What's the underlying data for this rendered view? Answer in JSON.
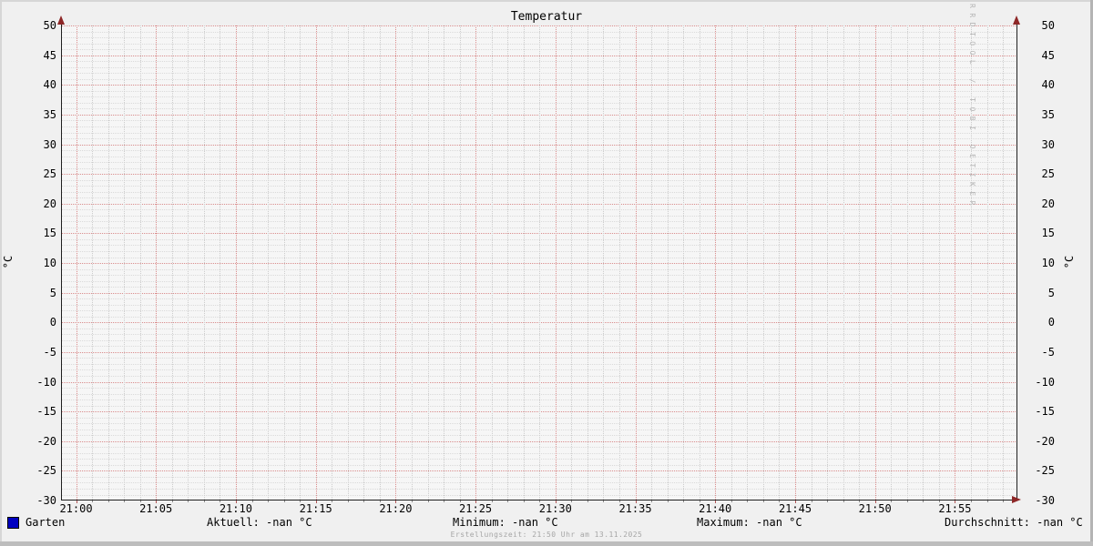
{
  "title": "Temperatur",
  "axes": {
    "y_unit_left": "°C",
    "y_unit_right": "°C"
  },
  "legend": {
    "series_label": "Garten",
    "series_swatch_color": "#0000c0",
    "stats": [
      {
        "text": "Aktuell: -nan °C"
      },
      {
        "text": "Minimum: -nan °C"
      },
      {
        "text": "Maximum: -nan °C"
      },
      {
        "text": "Durchschnitt: -nan °C"
      }
    ]
  },
  "footer": "Erstellungszeit: 21:50 Uhr am 13.11.2025",
  "watermark": "RRDTOOL / TOBI OETIKER",
  "chart_data": {
    "type": "line",
    "title": "Temperatur",
    "ylabel": "°C",
    "ylim": [
      -30,
      50
    ],
    "y_major_step": 5,
    "y_minor_step": 1,
    "y_tick_labels": [
      "50",
      "45",
      "40",
      "35",
      "30",
      "25",
      "20",
      "15",
      "10",
      "5",
      "0",
      "-5",
      "-10",
      "-15",
      "-20",
      "-25",
      "-30"
    ],
    "x_tick_labels": [
      "21:00",
      "21:05",
      "21:10",
      "21:15",
      "21:20",
      "21:25",
      "21:30",
      "21:35",
      "21:40",
      "21:45",
      "21:50",
      "21:55"
    ],
    "x_minor_per_major": 5,
    "grid": true,
    "legend_position": "bottom",
    "series": [
      {
        "name": "Garten",
        "color": "#0000c0",
        "values": [],
        "note": "no data plotted; all values -nan"
      }
    ],
    "stats": {
      "aktuell": "-nan °C",
      "minimum": "-nan °C",
      "maximum": "-nan °C",
      "durchschnitt": "-nan °C"
    },
    "style": {
      "grid_major_color": "#d98c8c",
      "grid_minor_h_color": "#dadada",
      "grid_minor_v_color": "#cccccc",
      "axis_color": "#1f1f1f",
      "arrow_color": "#8e2727",
      "tick_major_color": "#b05454",
      "tick_minor_color": "#8a8a8a",
      "canvas_color": "#f6f6f6",
      "background_color": "#f0f0f0"
    }
  }
}
